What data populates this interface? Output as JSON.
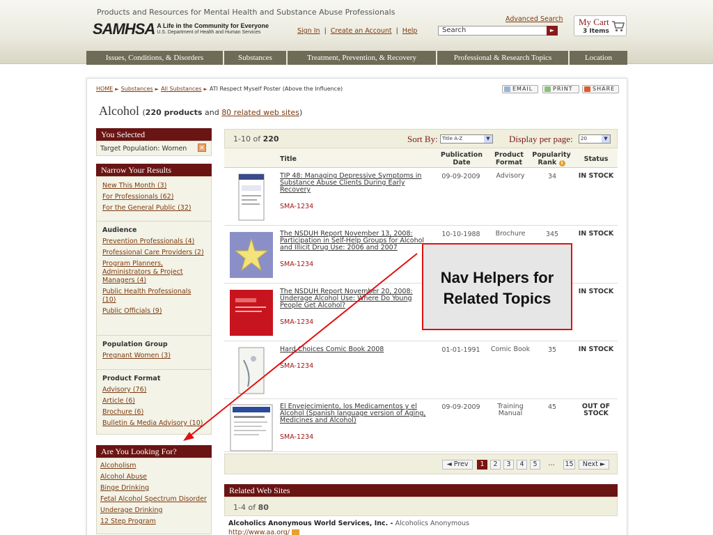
{
  "header": {
    "tagline": "Products and Resources for Mental Health and Substance Abuse Professionals",
    "logo_word": "SAMHSA",
    "logo_line1": "A Life in the Community for Everyone",
    "logo_line2": "U.S. Department of Health and Human Services",
    "sign_in": "Sign In",
    "create_account": "Create an Account",
    "help": "Help",
    "separator": "|",
    "advanced_search": "Advanced Search",
    "search_placeholder": "Search",
    "cart_title": "My Cart",
    "cart_items": "3 Items"
  },
  "nav": {
    "tabs": [
      {
        "label": "Issues, Conditions, & Disorders"
      },
      {
        "label": "Substances"
      },
      {
        "label": "Treatment, Prevention, & Recovery"
      },
      {
        "label": "Professional & Research Topics"
      },
      {
        "label": "Location"
      }
    ]
  },
  "breadcrumb": {
    "home": "HOME",
    "substances": "Substances",
    "all_substances": "All Substances",
    "current": "ATI Respect Myself Poster (Above the Influence)"
  },
  "share": {
    "email": "EMAIL",
    "print": "PRINT",
    "share": "SHARE"
  },
  "title": {
    "name": "Alcohol",
    "open": "(",
    "products": "220 products",
    "and": "and",
    "related": "80 related web sites",
    "close": ")"
  },
  "sidebar": {
    "you_selected": "You Selected",
    "selected_filter": "Target Population: Women",
    "narrow_title": "Narrow Your Results",
    "groups": [
      {
        "title": "",
        "links": [
          "New This Month (3)",
          "For Professionals (62)",
          "For the General Public (32)"
        ]
      },
      {
        "title": "Audience",
        "links": [
          "Prevention Professionals (4)",
          "Professional Care Providers (2)",
          "Program Planners, Administrators & Project Managers (4)",
          "Public Health Professionals (10)",
          "Public Officials (9)"
        ]
      },
      {
        "title": "Population Group",
        "links": [
          "Pregnant Women (3)"
        ]
      },
      {
        "title": "Product Format",
        "links": [
          "Advisory (76)",
          "Article (6)",
          "Brochure (6)",
          "Bulletin & Media Advisory (10)"
        ]
      }
    ],
    "looking_title": "Are You Looking For?",
    "looking_links": [
      "Alcoholism",
      "Alcohol Abuse",
      "Binge Drinking",
      "Fetal Alcohol Spectrum Disorder",
      "Underage Drinking",
      "12 Step Program"
    ]
  },
  "results": {
    "range": "1-10 of",
    "total": "220",
    "sort_label": "Sort By:",
    "sort_value": "Title A-Z",
    "perpage_label": "Display per page:",
    "perpage_value": "20",
    "columns": {
      "title": "Title",
      "date": "Publication Date",
      "format": "Product Format",
      "rank": "Popularity Rank",
      "status": "Status"
    },
    "rows": [
      {
        "title": "TIP 48: Managing Depressive Symptoms in Substance Abuse Clients During Early Recovery",
        "code": "SMA-1234",
        "date": "09-09-2009",
        "format": "Advisory",
        "rank": "34",
        "status": "IN STOCK"
      },
      {
        "title": "The NSDUH Report November 13, 2008: Participation in Self-Help Groups for Alcohol and Illicit Drug Use: 2006 and 2007",
        "code": "SMA-1234",
        "date": "10-10-1988",
        "format": "Brochure",
        "rank": "345",
        "status": "IN STOCK"
      },
      {
        "title": "The NSDUH Report November 20, 2008: Underage Alcohol Use: Where Do Young People Get Alcohol?",
        "code": "SMA-1234",
        "date": "",
        "format": "",
        "rank": "",
        "status": "IN STOCK"
      },
      {
        "title": "Hard Choices Comic Book 2008",
        "code": "SMA-1234",
        "date": "01-01-1991",
        "format": "Comic Book",
        "rank": "35",
        "status": "IN STOCK"
      },
      {
        "title": "El Envejecimiento, los Medicamentos y el Alcohol (Spanish language version of Aging, Medicines and Alcohol)",
        "code": "SMA-1234",
        "date": "09-09-2009",
        "format": "Training Manual",
        "rank": "45",
        "status": "OUT OF STOCK"
      }
    ]
  },
  "pager": {
    "prev": "◄ Prev",
    "pages": [
      "1",
      "2",
      "3",
      "4",
      "5",
      "…",
      "15"
    ],
    "next": "Next ►",
    "current": "1"
  },
  "related": {
    "title": "Related Web Sites",
    "range": "1-4 of",
    "total": "80",
    "item_name": "Alcoholics Anonymous World Services, Inc. -",
    "item_desc": "Alcoholics Anonymous",
    "item_url": "http://www.aa.org/"
  },
  "callout": {
    "line1": "Nav Helpers for",
    "line2": "Related Topics"
  },
  "icons": {
    "remove_filter": "close-icon",
    "cart": "cart-icon",
    "rank_info": "info-icon",
    "search_go": "arrow-right-icon"
  },
  "colors": {
    "brand_red": "#6a1414",
    "nav_bg": "#6e6b56",
    "link": "#7a3a10",
    "callout_border": "#e01010"
  }
}
